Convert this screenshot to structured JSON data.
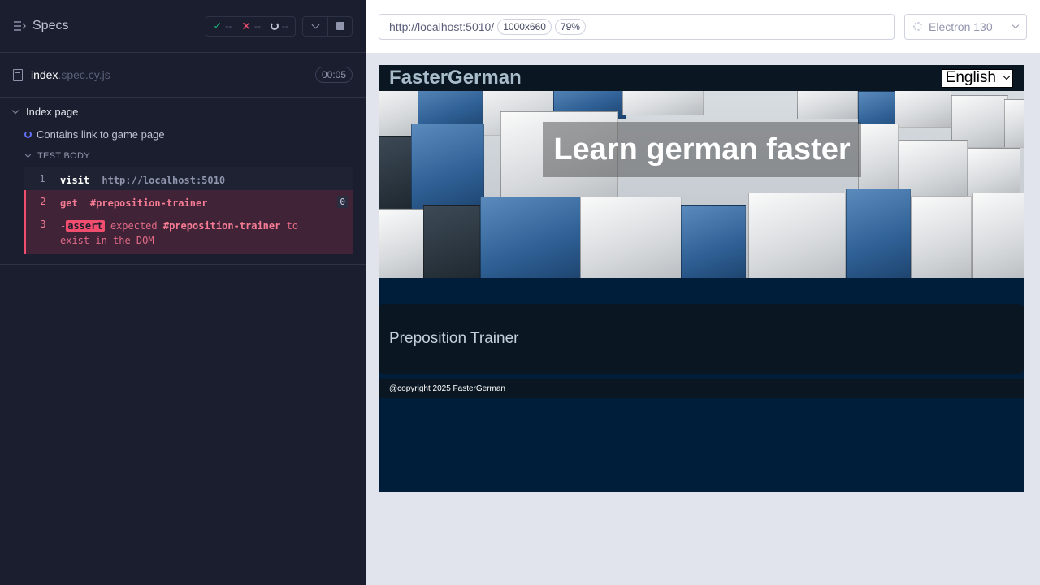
{
  "reporter": {
    "specs_label": "Specs",
    "stats": {
      "passed": "--",
      "failed": "--",
      "pending": "--"
    },
    "spec_file": {
      "name": "index",
      "ext": ".spec.cy.js",
      "duration": "00:05"
    },
    "suite": {
      "title": "Index page"
    },
    "test": {
      "title": "Contains link to game page"
    },
    "test_body_label": "TEST BODY",
    "commands": [
      {
        "num": "1",
        "name": "visit",
        "message": "http://localhost:5010"
      },
      {
        "num": "2",
        "name": "get",
        "message": "#preposition-trainer",
        "count": "0"
      },
      {
        "num": "3",
        "prefix": "-",
        "name": "assert",
        "expected": "expected",
        "selector": "#preposition-trainer",
        "to": "to",
        "rest": "exist in the DOM"
      }
    ]
  },
  "aut": {
    "url": "http://localhost:5010/",
    "viewport": "1000x660",
    "zoom": "79%",
    "browser": "Electron 130"
  },
  "app": {
    "logo": "FasterGerman",
    "language": "English",
    "hero_title": "Learn german faster",
    "card_title": "Preposition Trainer",
    "footer": "@copyright 2025 FasterGerman"
  },
  "colors": {
    "pass": "#1fa971",
    "fail": "#f14d6e",
    "running": "#6470f3",
    "app_background": "#001d3a"
  }
}
